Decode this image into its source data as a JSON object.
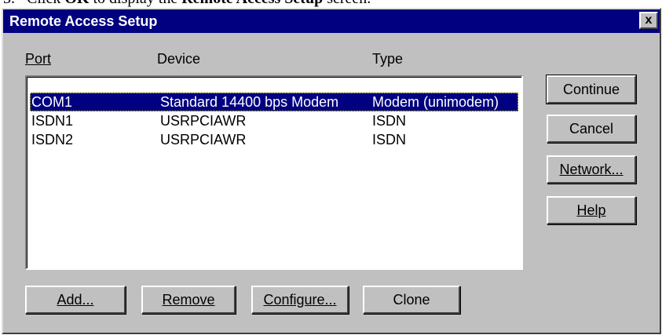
{
  "caption": {
    "number": "3.",
    "prefix": "Click ",
    "ok": "OK",
    "middle": " to display the ",
    "bold_target": "Remote Access Setup",
    "suffix": " screen."
  },
  "window": {
    "title": "Remote Access Setup",
    "close_label": "x"
  },
  "columns": {
    "port": "Port",
    "device": "Device",
    "type": "Type"
  },
  "ports": [
    {
      "port": "COM1",
      "device": "Standard 14400 bps Modem",
      "type": "Modem (unimodem)",
      "selected": true
    },
    {
      "port": "ISDN1",
      "device": "USRPCIAWR",
      "type": "ISDN",
      "selected": false
    },
    {
      "port": "ISDN2",
      "device": "USRPCIAWR",
      "type": "ISDN",
      "selected": false
    }
  ],
  "buttons": {
    "continue": "Continue",
    "cancel": "Cancel",
    "network": "Network...",
    "help": "Help",
    "add": "Add...",
    "remove": "Remove",
    "configure": "Configure...",
    "clone": "Clone"
  },
  "colors": {
    "titlebar": "#000080",
    "face": "#c0c0c0",
    "selection": "#000080"
  }
}
